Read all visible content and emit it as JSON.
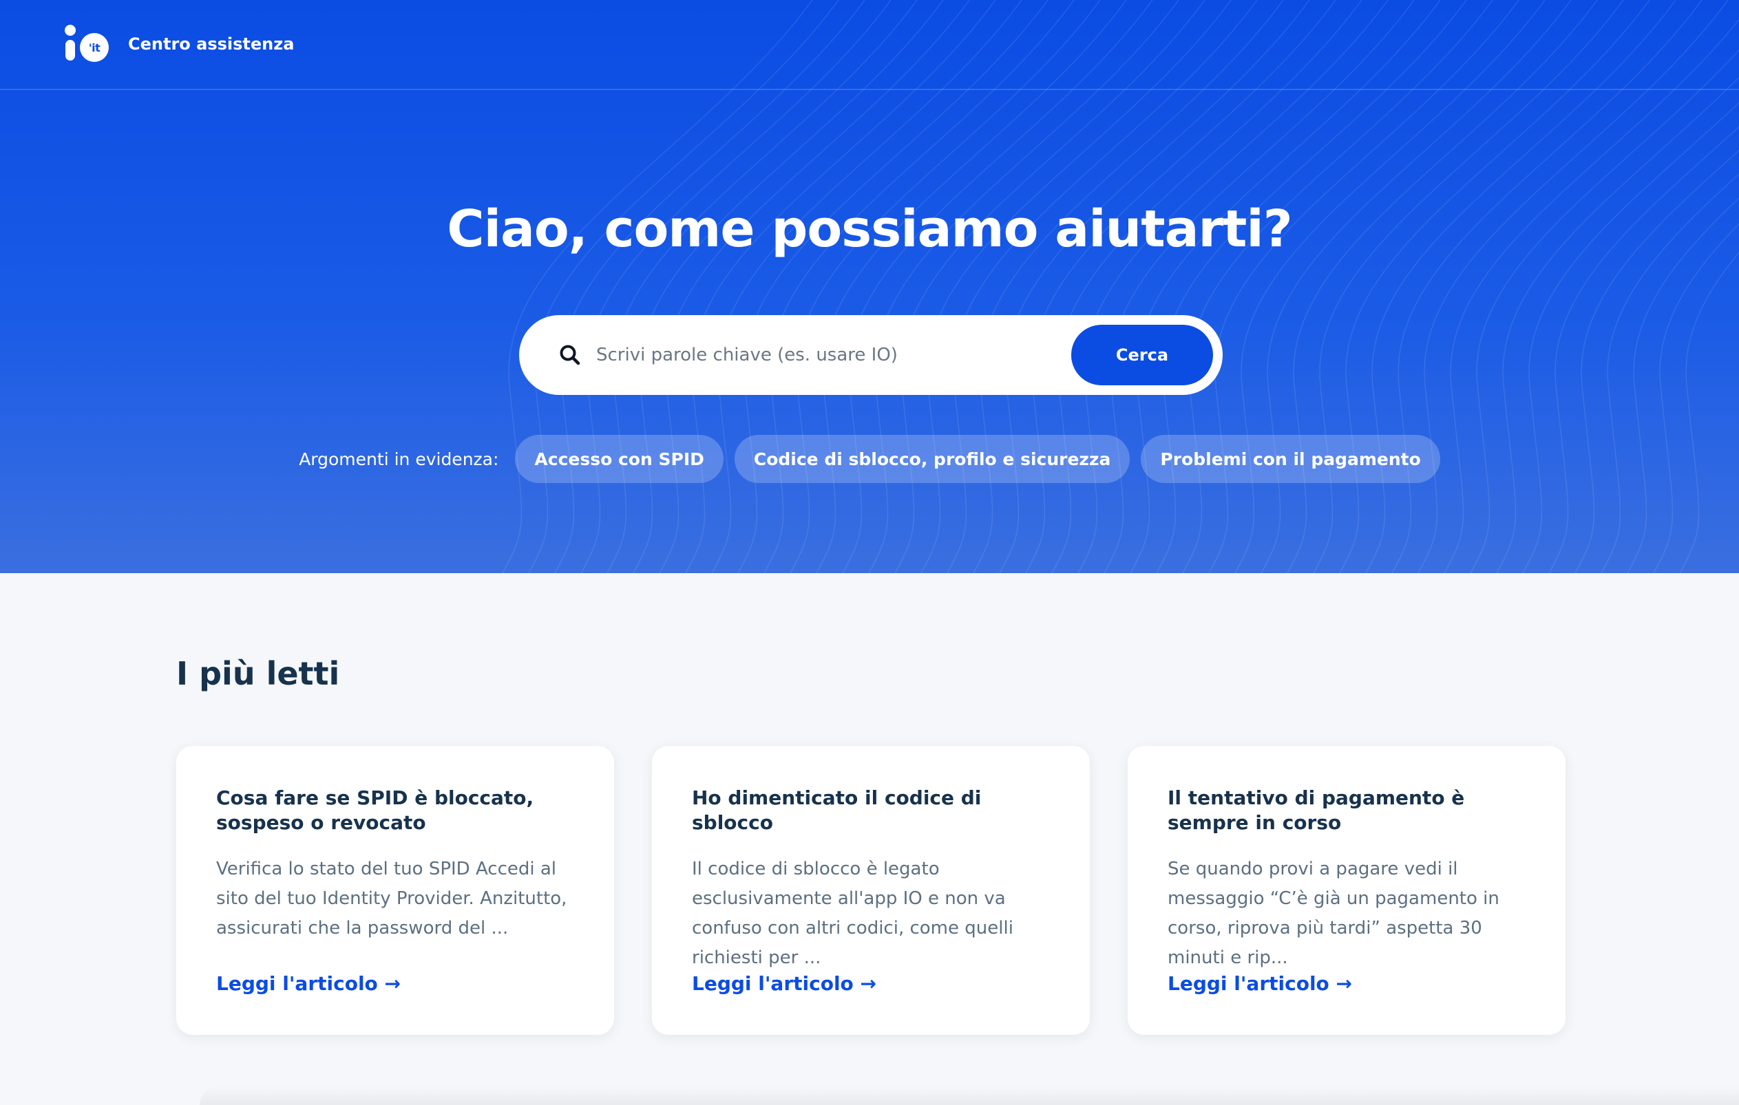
{
  "header": {
    "logo_text": "'it",
    "brand_label": "Centro assistenza"
  },
  "hero": {
    "title": "Ciao, come possiamo aiutarti?",
    "search": {
      "placeholder": "Scrivi parole chiave (es. usare IO)",
      "value": "",
      "button_label": "Cerca"
    },
    "featured": {
      "label": "Argomenti in evidenza:",
      "chips": [
        "Accesso con SPID",
        "Codice di sblocco, profilo e sicurezza",
        "Problemi con il pagamento"
      ]
    }
  },
  "most_read": {
    "title": "I più letti",
    "cards": [
      {
        "title": "Cosa fare se SPID è bloccato, sospeso o revocato",
        "text": "Verifica lo stato del tuo SPID Accedi al sito del tuo Identity Provider. Anzitutto, assicurati che la password del ...",
        "link": "Leggi l'articolo →"
      },
      {
        "title": "Ho dimenticato il codice di sblocco",
        "text": "Il codice di sblocco è legato esclusivamente all'app IO e non va confuso con altri codici, come quelli richiesti per ...",
        "link": "Leggi l'articolo →"
      },
      {
        "title": "Il tentativo di pagamento è sempre in corso",
        "text": "Se quando provi a pagare vedi il messaggio “C’è già un pagamento in corso, riprova più tardi” aspetta 30 minuti e rip...",
        "link": "Leggi l'articolo →"
      }
    ]
  },
  "colors": {
    "brand_blue": "#0b4ce3",
    "heading": "#17324d",
    "body_text": "#5c6f82",
    "page_bg": "#f5f7fa"
  }
}
